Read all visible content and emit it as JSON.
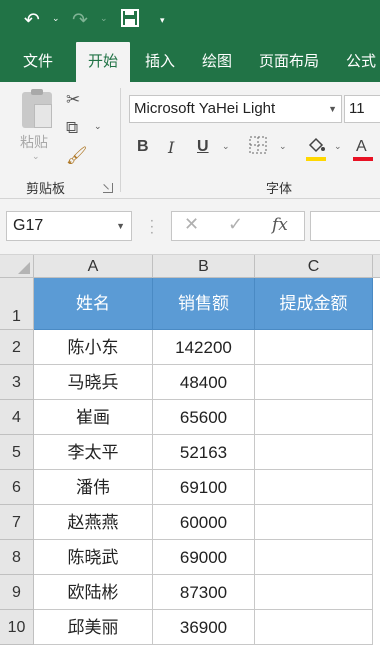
{
  "quick_access": {
    "undo_icon": "undo-icon",
    "redo_icon": "redo-icon",
    "save_icon": "save-icon",
    "customize_icon": "customize-qat-icon"
  },
  "tabs": [
    {
      "label": "文件",
      "active": false
    },
    {
      "label": "开始",
      "active": true
    },
    {
      "label": "插入",
      "active": false
    },
    {
      "label": "绘图",
      "active": false
    },
    {
      "label": "页面布局",
      "active": false
    },
    {
      "label": "公式",
      "active": false
    }
  ],
  "ribbon": {
    "clipboard": {
      "paste_label": "粘贴",
      "group_label": "剪贴板"
    },
    "font": {
      "font_name": "Microsoft YaHei Light",
      "font_size": "11",
      "bold_label": "B",
      "italic_label": "I",
      "underline_label": "U",
      "group_label": "字体",
      "fill_color": "#ffd700",
      "font_color": "#e81123"
    }
  },
  "formula_bar": {
    "name_box": "G17",
    "fx_label": "fx",
    "formula": ""
  },
  "sheet": {
    "columns": [
      "A",
      "B",
      "C"
    ],
    "rows": [
      "1",
      "2",
      "3",
      "4",
      "5",
      "6",
      "7",
      "8",
      "9",
      "10"
    ],
    "header": [
      "姓名",
      "销售额",
      "提成金额"
    ],
    "header_color": "#5b9bd5",
    "data": [
      [
        "陈小东",
        "142200",
        ""
      ],
      [
        "马晓兵",
        "48400",
        ""
      ],
      [
        "崔画",
        "65600",
        ""
      ],
      [
        "李太平",
        "52163",
        ""
      ],
      [
        "潘伟",
        "69100",
        ""
      ],
      [
        "赵燕燕",
        "60000",
        ""
      ],
      [
        "陈晓武",
        "69000",
        ""
      ],
      [
        "欧陆彬",
        "87300",
        ""
      ],
      [
        "邱美丽",
        "36900",
        ""
      ]
    ]
  }
}
